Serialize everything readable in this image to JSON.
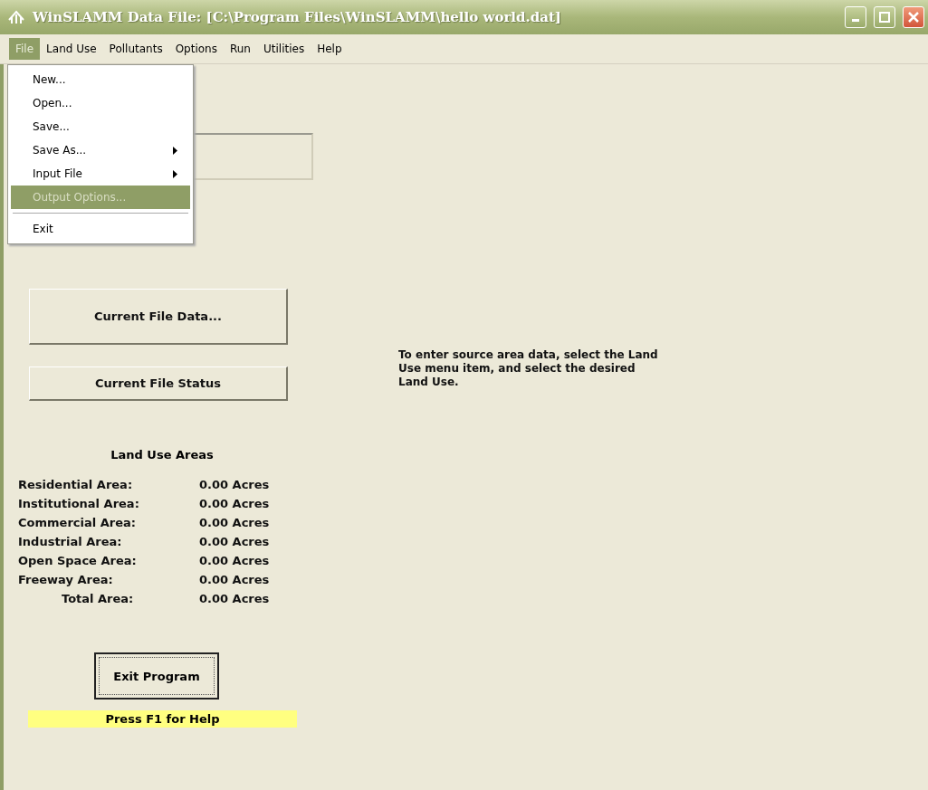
{
  "window": {
    "title": "WinSLAMM Data File: [C:\\Program Files\\WinSLAMM\\hello world.dat]"
  },
  "menu_bar": [
    {
      "label": "File",
      "selected": true
    },
    {
      "label": "Land Use",
      "selected": false
    },
    {
      "label": "Pollutants",
      "selected": false
    },
    {
      "label": "Options",
      "selected": false
    },
    {
      "label": "Run",
      "selected": false
    },
    {
      "label": "Utilities",
      "selected": false
    },
    {
      "label": "Help",
      "selected": false
    }
  ],
  "file_menu": [
    {
      "kind": "item",
      "label": "New...",
      "submenu": false,
      "selected": false
    },
    {
      "kind": "item",
      "label": "Open...",
      "submenu": false,
      "selected": false
    },
    {
      "kind": "item",
      "label": "Save...",
      "submenu": false,
      "selected": false
    },
    {
      "kind": "item",
      "label": "Save As...",
      "submenu": true,
      "selected": false
    },
    {
      "kind": "item",
      "label": "Input File",
      "submenu": true,
      "selected": false
    },
    {
      "kind": "item",
      "label": "Output Options...",
      "submenu": false,
      "selected": true
    },
    {
      "kind": "separator"
    },
    {
      "kind": "item",
      "label": "Exit",
      "submenu": false,
      "selected": false
    }
  ],
  "buttons": [
    {
      "label": "Current File Data..."
    },
    {
      "label": "Current File Status"
    }
  ],
  "instructions": "To enter source area data, select the Land Use menu item, and select the desired Land Use.",
  "land_use_areas": {
    "title": "Land Use Areas",
    "rows": [
      {
        "kind": "area",
        "label": "Residential Area:",
        "value": "0.00 Acres"
      },
      {
        "kind": "area",
        "label": "Institutional Area:",
        "value": "0.00 Acres"
      },
      {
        "kind": "area",
        "label": "Commercial Area:",
        "value": "0.00 Acres"
      },
      {
        "kind": "area",
        "label": "Industrial Area:",
        "value": "0.00 Acres"
      },
      {
        "kind": "area",
        "label": "Open Space Area:",
        "value": "0.00 Acres"
      },
      {
        "kind": "area",
        "label": "Freeway Area:",
        "value": "0.00 Acres"
      },
      {
        "kind": "total",
        "label": "Total Area:",
        "value": "0.00 Acres"
      }
    ]
  },
  "exit_button": {
    "label": "Exit Program"
  },
  "status_hint": "Press F1 for Help"
}
